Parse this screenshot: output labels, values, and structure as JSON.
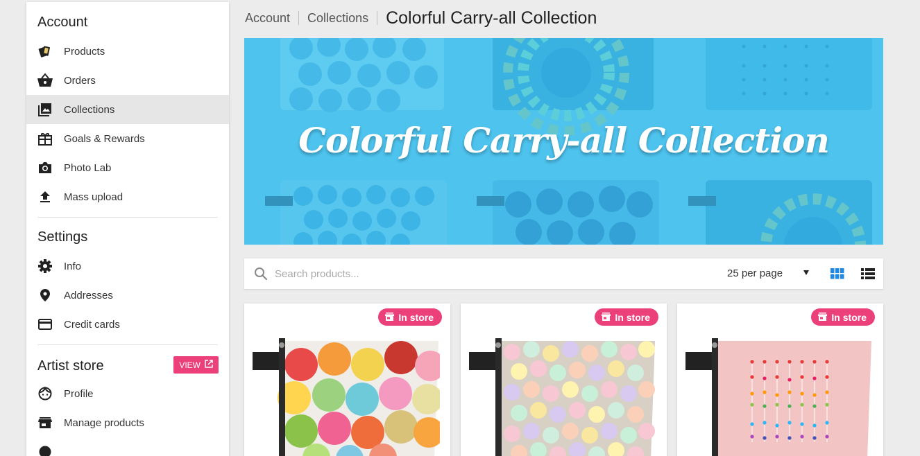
{
  "sidebar": {
    "account": {
      "title": "Account",
      "items": [
        {
          "label": "Products",
          "icon": "products-icon"
        },
        {
          "label": "Orders",
          "icon": "basket-icon"
        },
        {
          "label": "Collections",
          "icon": "collections-icon",
          "active": true
        },
        {
          "label": "Goals & Rewards",
          "icon": "gift-icon"
        },
        {
          "label": "Photo Lab",
          "icon": "camera-icon"
        },
        {
          "label": "Mass upload",
          "icon": "upload-icon"
        }
      ]
    },
    "settings": {
      "title": "Settings",
      "items": [
        {
          "label": "Info",
          "icon": "gear-icon"
        },
        {
          "label": "Addresses",
          "icon": "location-pin-icon"
        },
        {
          "label": "Credit cards",
          "icon": "credit-card-icon"
        }
      ]
    },
    "artist_store": {
      "title": "Artist store",
      "view_label": "VIEW",
      "items": [
        {
          "label": "Profile",
          "icon": "face-icon"
        },
        {
          "label": "Manage products",
          "icon": "store-icon"
        }
      ]
    }
  },
  "breadcrumb": {
    "items": [
      "Account",
      "Collections"
    ],
    "current": "Colorful Carry-all Collection"
  },
  "banner": {
    "title": "Colorful Carry-all Collection",
    "background": "#4dc3ee"
  },
  "toolbar": {
    "search_placeholder": "Search products...",
    "per_page": "25 per page",
    "active_view": "grid"
  },
  "products": [
    {
      "badge": "In store",
      "design": "macarons"
    },
    {
      "badge": "In store",
      "design": "candy-hearts"
    },
    {
      "badge": "In store",
      "design": "pink-dots"
    }
  ],
  "colors": {
    "accent": "#ec407a",
    "view_active": "#1e88e5",
    "banner": "#4dc3ee"
  }
}
